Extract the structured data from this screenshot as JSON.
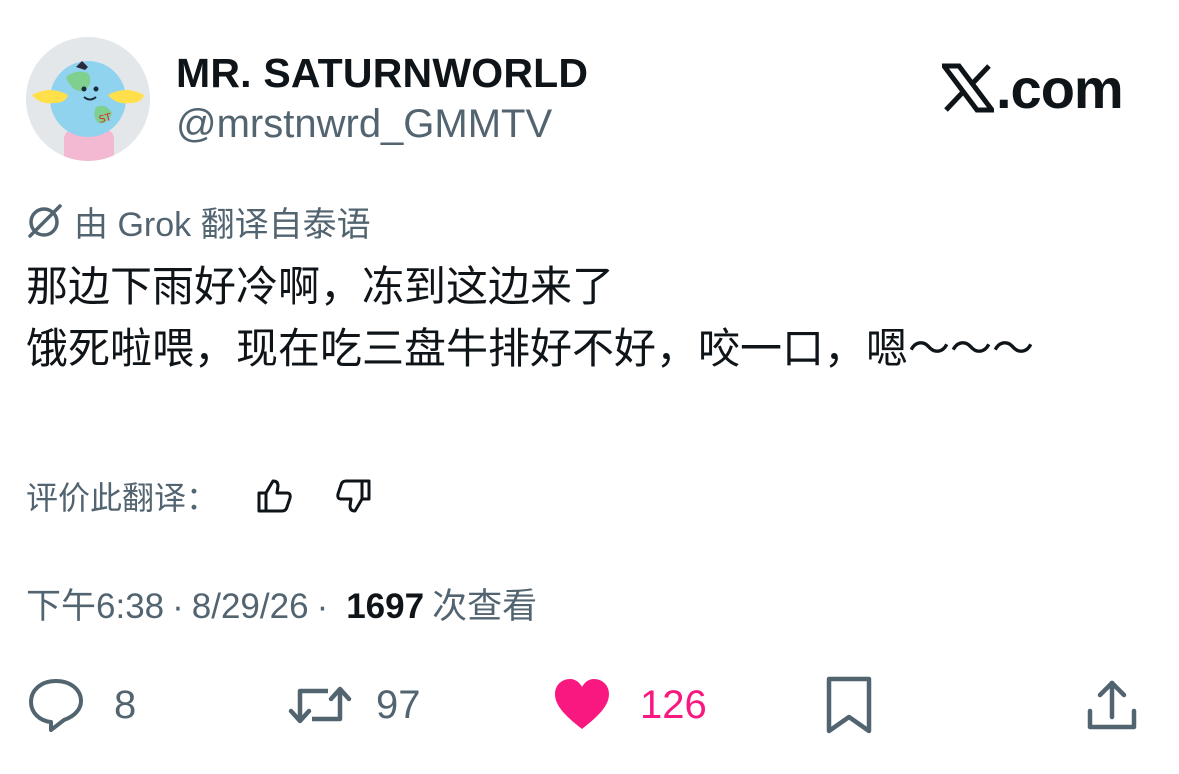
{
  "author": {
    "display_name": "MR. SATURNWORLD",
    "handle": "@mrstnwrd_GMMTV"
  },
  "brand": {
    "logo_icon": "x-logo-icon",
    "domain_text": ".com"
  },
  "translation": {
    "label": "由 Grok 翻译自泰语",
    "rate_label": "评价此翻译："
  },
  "tweet": {
    "text": "那边下雨好冷啊，冻到这边来了\n饿死啦喂，现在吃三盘牛排好不好，咬一口，嗯～～～"
  },
  "meta": {
    "time": "下午6:38",
    "separator": "·",
    "date": "8/29/26",
    "views": "1697",
    "views_label": "次查看"
  },
  "actions": {
    "replies": "8",
    "retweets": "97",
    "likes": "126",
    "like_color": "#f91880"
  },
  "colors": {
    "text_primary": "#0f1419",
    "text_secondary": "#536471",
    "like_active": "#f91880"
  }
}
